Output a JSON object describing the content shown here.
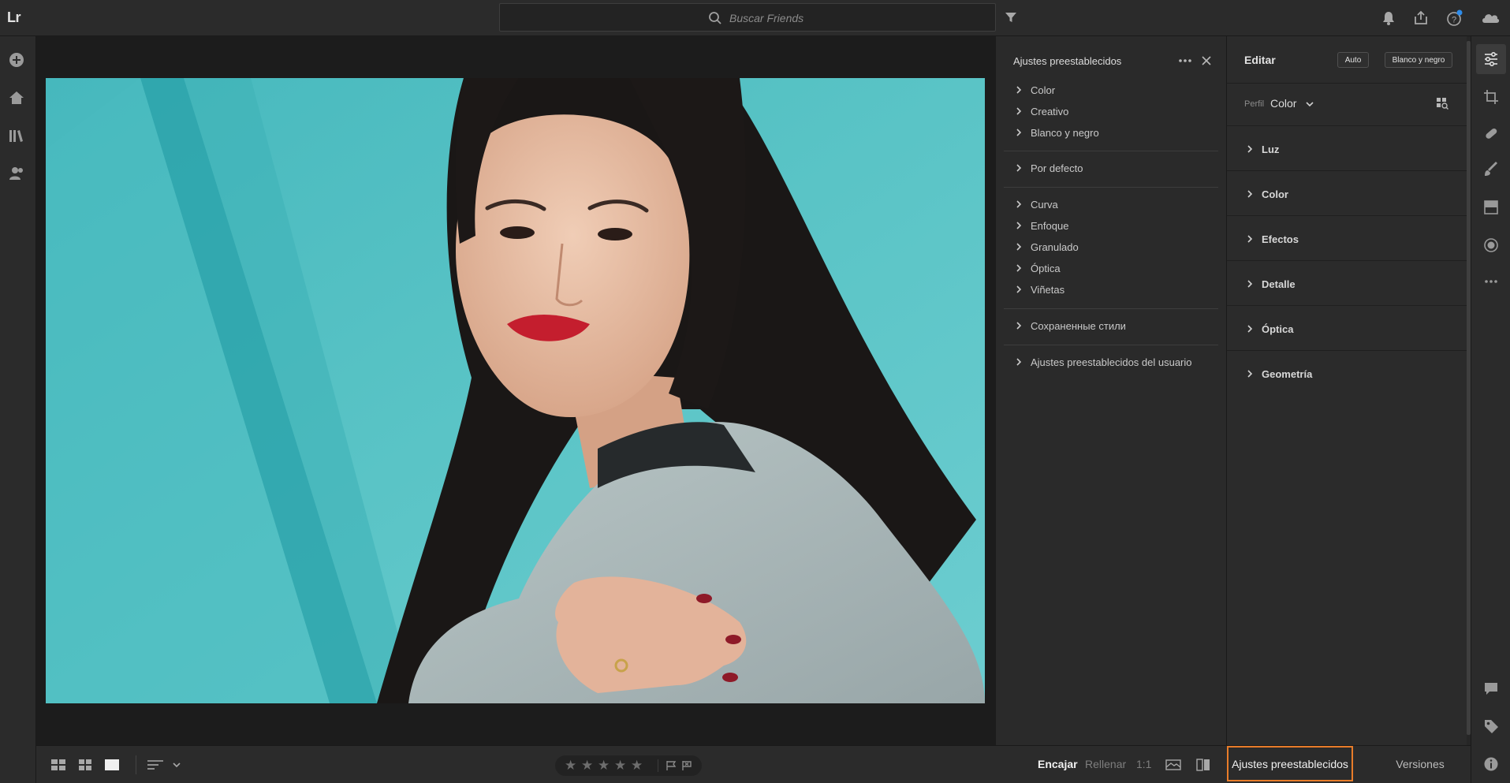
{
  "app": {
    "logo": "Lr"
  },
  "topbar": {
    "search_placeholder": "Buscar Friends",
    "icons": [
      "search-icon",
      "filter-icon",
      "notifications-icon",
      "share-icon",
      "help-icon",
      "cloud-icon"
    ],
    "help_badge_color": "#2d8ceb"
  },
  "leftnav": {
    "icons": [
      "add-photos-icon",
      "home-icon",
      "library-icon",
      "people-icon"
    ]
  },
  "presets_panel": {
    "title": "Ajustes preestablecidos",
    "groups": [
      [
        "Color",
        "Creativo",
        "Blanco y negro"
      ],
      [
        "Por defecto"
      ],
      [
        "Curva",
        "Enfoque",
        "Granulado",
        "Óptica",
        "Viñetas"
      ],
      [
        "Сохраненные стили"
      ],
      [
        "Ajustes preestablecidos del usuario"
      ]
    ]
  },
  "edit_panel": {
    "title": "Editar",
    "auto_button": "Auto",
    "bw_button": "Blanco y negro",
    "profile_label": "Perfil",
    "profile_value": "Color",
    "sections": [
      "Luz",
      "Color",
      "Efectos",
      "Detalle",
      "Óptica",
      "Geometría"
    ]
  },
  "rightstrip": {
    "icons": [
      "edit-sliders-icon",
      "crop-icon",
      "healing-icon",
      "brush-icon",
      "linear-gradient-icon",
      "radial-gradient-icon",
      "more-icon",
      "comments-icon",
      "keywords-icon",
      "info-icon"
    ]
  },
  "bottombar": {
    "view_fit": "Encajar",
    "view_fill": "Rellenar",
    "view_one_to_one": "1:1",
    "tab_presets": "Ajustes preestablecidos",
    "tab_versions": "Versiones",
    "stars": [
      "★",
      "★",
      "★",
      "★",
      "★"
    ],
    "accent_color": "#e87c29"
  }
}
